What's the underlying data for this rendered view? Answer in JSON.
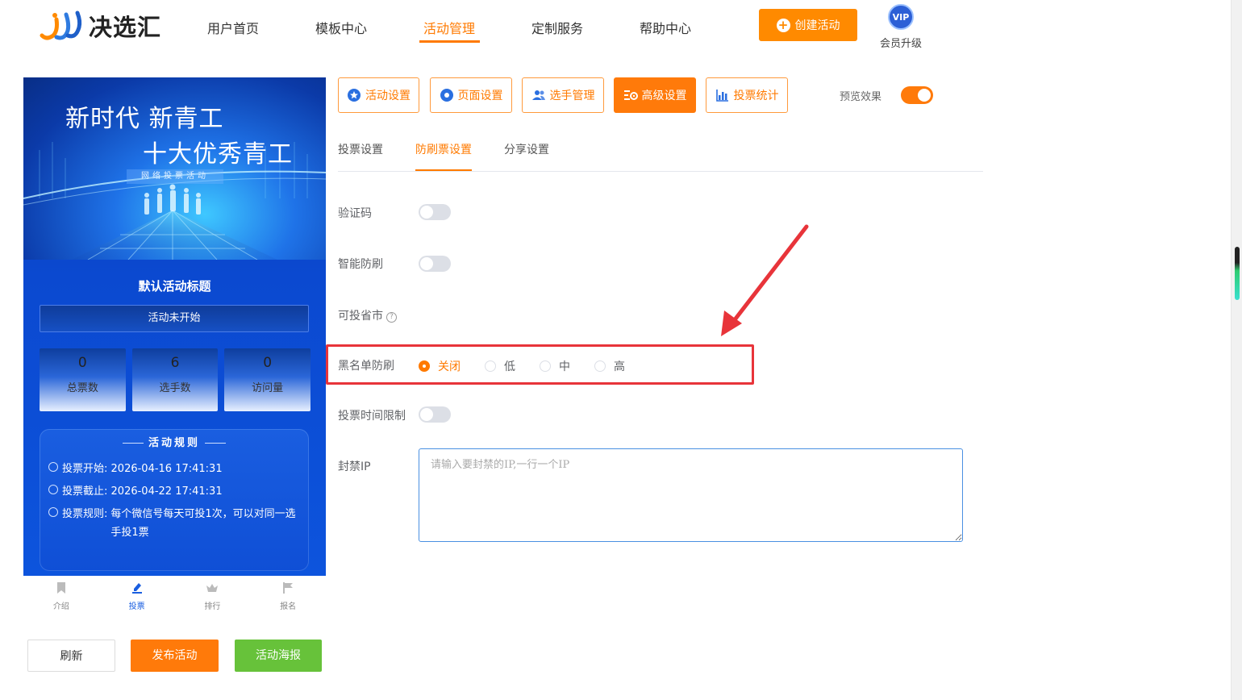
{
  "brand": {
    "name": "决选汇"
  },
  "nav": {
    "items": [
      {
        "label": "用户首页",
        "active": false
      },
      {
        "label": "模板中心",
        "active": false
      },
      {
        "label": "活动管理",
        "active": true
      },
      {
        "label": "定制服务",
        "active": false
      },
      {
        "label": "帮助中心",
        "active": false
      }
    ],
    "create_label": "创建活动",
    "vip_badge": "VIP",
    "vip_label": "会员升级"
  },
  "preview": {
    "banner_line1": "新时代 新青工",
    "banner_line2": "十大优秀青工",
    "banner_sub": "网络投票活动",
    "activity_title": "默认活动标题",
    "status": "活动未开始",
    "stats": [
      {
        "value": "0",
        "label": "总票数"
      },
      {
        "value": "6",
        "label": "选手数"
      },
      {
        "value": "0",
        "label": "访问量"
      }
    ],
    "rules_title": "活动规则",
    "rules": [
      {
        "key": "投票开始:",
        "value": "2026-04-16 17:41:31"
      },
      {
        "key": "投票截止:",
        "value": "2026-04-22 17:41:31"
      },
      {
        "key": "投票规则:",
        "value": "每个微信号每天可投1次，可以对同一选手投1票"
      }
    ],
    "tabs": [
      {
        "label": "介绍",
        "icon": "bookmark-icon",
        "active": false
      },
      {
        "label": "投票",
        "icon": "vote-icon",
        "active": true
      },
      {
        "label": "排行",
        "icon": "crown-icon",
        "active": false
      },
      {
        "label": "报名",
        "icon": "flag-icon",
        "active": false
      }
    ]
  },
  "bottom_buttons": {
    "refresh": "刷新",
    "publish": "发布活动",
    "poster": "活动海报"
  },
  "toolbar": {
    "buttons": [
      {
        "label": "活动设置",
        "icon": "star-circle-icon",
        "active": false
      },
      {
        "label": "页面设置",
        "icon": "flower-icon",
        "active": false
      },
      {
        "label": "选手管理",
        "icon": "users-icon",
        "active": false
      },
      {
        "label": "高级设置",
        "icon": "gear-list-icon",
        "active": true
      },
      {
        "label": "投票统计",
        "icon": "bar-chart-icon",
        "active": false
      }
    ],
    "preview_label": "预览效果",
    "preview_on": true
  },
  "subtabs": [
    {
      "label": "投票设置",
      "active": false
    },
    {
      "label": "防刷票设置",
      "active": true
    },
    {
      "label": "分享设置",
      "active": false
    }
  ],
  "form": {
    "captcha_label": "验证码",
    "smart_label": "智能防刷",
    "province_label": "可投省市",
    "blacklist_label": "黑名单防刷",
    "blacklist_options": [
      "关闭",
      "低",
      "中",
      "高"
    ],
    "blacklist_selected": "关闭",
    "time_limit_label": "投票时间限制",
    "ban_ip_label": "封禁IP",
    "ban_ip_placeholder": "请输入要封禁的IP,一行一个IP",
    "ban_ip_value": ""
  },
  "colors": {
    "accent": "#ff7a00",
    "success": "#67c23a",
    "highlight": "#e8343a",
    "input_border": "#4a90e2"
  }
}
